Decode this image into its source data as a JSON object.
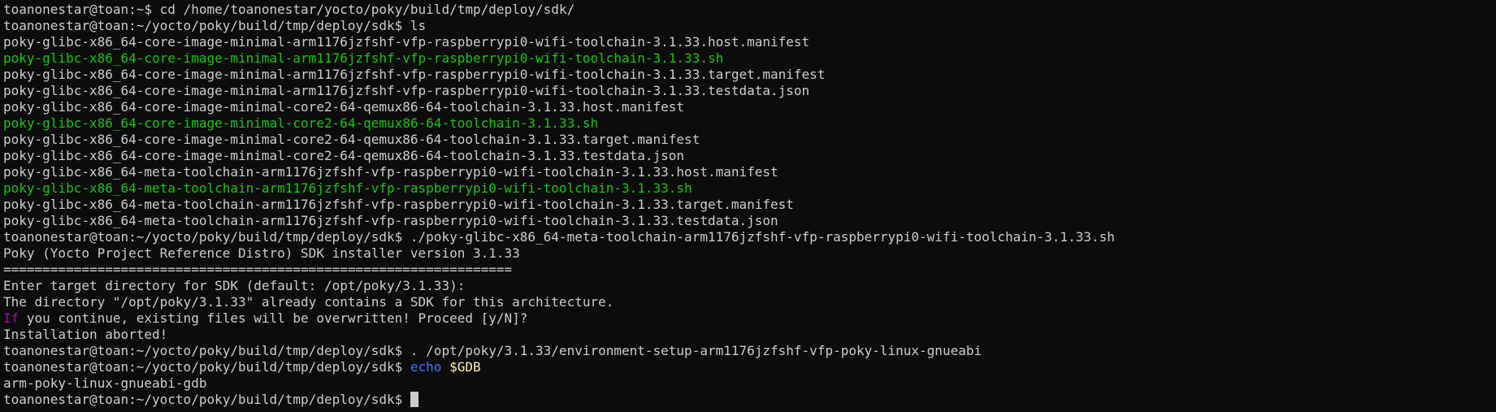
{
  "colors": {
    "background": "#0c0c0c",
    "default": "#cccccc",
    "exec": "#16c60c",
    "magenta": "#b4009e",
    "blue": "#3b78ff",
    "yellow": "#f9f1a5"
  },
  "lines": [
    {
      "segments": [
        {
          "text": "toanonestar@toan:~$ cd /home/toanonestar/yocto/poky/build/tmp/deploy/sdk/",
          "color": "default"
        }
      ]
    },
    {
      "segments": [
        {
          "text": "toanonestar@toan:~/yocto/poky/build/tmp/deploy/sdk$ ls",
          "color": "default"
        }
      ]
    },
    {
      "segments": [
        {
          "text": "poky-glibc-x86_64-core-image-minimal-arm1176jzfshf-vfp-raspberrypi0-wifi-toolchain-3.1.33.host.manifest",
          "color": "default"
        }
      ]
    },
    {
      "segments": [
        {
          "text": "poky-glibc-x86_64-core-image-minimal-arm1176jzfshf-vfp-raspberrypi0-wifi-toolchain-3.1.33.sh",
          "color": "exec"
        }
      ]
    },
    {
      "segments": [
        {
          "text": "poky-glibc-x86_64-core-image-minimal-arm1176jzfshf-vfp-raspberrypi0-wifi-toolchain-3.1.33.target.manifest",
          "color": "default"
        }
      ]
    },
    {
      "segments": [
        {
          "text": "poky-glibc-x86_64-core-image-minimal-arm1176jzfshf-vfp-raspberrypi0-wifi-toolchain-3.1.33.testdata.json",
          "color": "default"
        }
      ]
    },
    {
      "segments": [
        {
          "text": "poky-glibc-x86_64-core-image-minimal-core2-64-qemux86-64-toolchain-3.1.33.host.manifest",
          "color": "default"
        }
      ]
    },
    {
      "segments": [
        {
          "text": "poky-glibc-x86_64-core-image-minimal-core2-64-qemux86-64-toolchain-3.1.33.sh",
          "color": "exec"
        }
      ]
    },
    {
      "segments": [
        {
          "text": "poky-glibc-x86_64-core-image-minimal-core2-64-qemux86-64-toolchain-3.1.33.target.manifest",
          "color": "default"
        }
      ]
    },
    {
      "segments": [
        {
          "text": "poky-glibc-x86_64-core-image-minimal-core2-64-qemux86-64-toolchain-3.1.33.testdata.json",
          "color": "default"
        }
      ]
    },
    {
      "segments": [
        {
          "text": "poky-glibc-x86_64-meta-toolchain-arm1176jzfshf-vfp-raspberrypi0-wifi-toolchain-3.1.33.host.manifest",
          "color": "default"
        }
      ]
    },
    {
      "segments": [
        {
          "text": "poky-glibc-x86_64-meta-toolchain-arm1176jzfshf-vfp-raspberrypi0-wifi-toolchain-3.1.33.sh",
          "color": "exec"
        }
      ]
    },
    {
      "segments": [
        {
          "text": "poky-glibc-x86_64-meta-toolchain-arm1176jzfshf-vfp-raspberrypi0-wifi-toolchain-3.1.33.target.manifest",
          "color": "default"
        }
      ]
    },
    {
      "segments": [
        {
          "text": "poky-glibc-x86_64-meta-toolchain-arm1176jzfshf-vfp-raspberrypi0-wifi-toolchain-3.1.33.testdata.json",
          "color": "default"
        }
      ]
    },
    {
      "segments": [
        {
          "text": "toanonestar@toan:~/yocto/poky/build/tmp/deploy/sdk$ ./poky-glibc-x86_64-meta-toolchain-arm1176jzfshf-vfp-raspberrypi0-wifi-toolchain-3.1.33.sh",
          "color": "default"
        }
      ]
    },
    {
      "segments": [
        {
          "text": "Poky (Yocto Project Reference Distro) SDK installer version 3.1.33",
          "color": "default"
        }
      ]
    },
    {
      "segments": [
        {
          "text": "=================================================================",
          "color": "default"
        }
      ]
    },
    {
      "segments": [
        {
          "text": "Enter target directory for SDK (default: /opt/poky/3.1.33):",
          "color": "default"
        }
      ]
    },
    {
      "segments": [
        {
          "text": "The directory \"/opt/poky/3.1.33\" already contains a SDK for this architecture.",
          "color": "default"
        }
      ]
    },
    {
      "segments": [
        {
          "text": "If",
          "color": "magenta"
        },
        {
          "text": " you continue, existing files will be overwritten! Proceed [y/N]?",
          "color": "default"
        }
      ]
    },
    {
      "segments": [
        {
          "text": "Installation aborted!",
          "color": "default"
        }
      ]
    },
    {
      "segments": [
        {
          "text": "toanonestar@toan:~/yocto/poky/build/tmp/deploy/sdk$ . /opt/poky/3.1.33/environment-setup-arm1176jzfshf-vfp-poky-linux-gnueabi",
          "color": "default"
        }
      ]
    },
    {
      "segments": [
        {
          "text": "toanonestar@toan:~/yocto/poky/build/tmp/deploy/sdk$ ",
          "color": "default"
        },
        {
          "text": "echo",
          "color": "blue"
        },
        {
          "text": " ",
          "color": "default"
        },
        {
          "text": "$GDB",
          "color": "yellow"
        }
      ]
    },
    {
      "segments": [
        {
          "text": "arm-poky-linux-gnueabi-gdb",
          "color": "default"
        }
      ]
    },
    {
      "segments": [
        {
          "text": "toanonestar@toan:~/yocto/poky/build/tmp/deploy/sdk$ ",
          "color": "default"
        }
      ],
      "cursor": true
    }
  ]
}
